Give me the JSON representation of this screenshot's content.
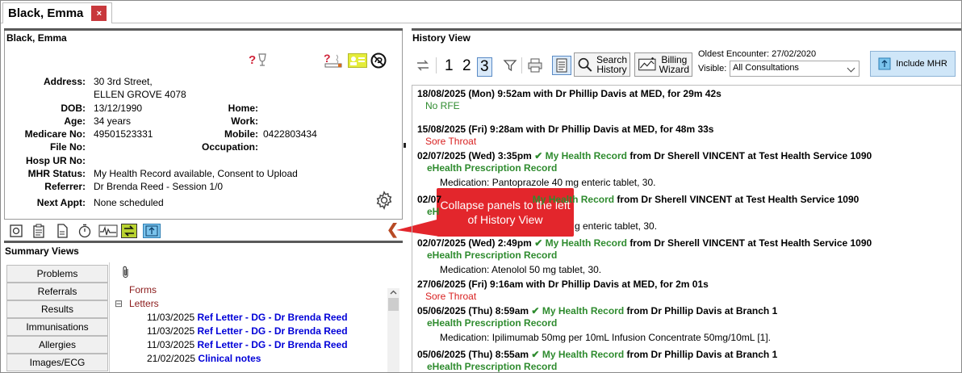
{
  "tab": {
    "title": "Black, Emma",
    "close": "×"
  },
  "patient": {
    "name": "Black, Emma",
    "fields": {
      "address_label": "Address:",
      "address_line1": "30 3rd Street,",
      "address_line2": "ELLEN GROVE  4078",
      "dob_label": "DOB:",
      "dob": "13/12/1990",
      "age_label": "Age:",
      "age": "34 years",
      "medicare_label": "Medicare No:",
      "medicare": "49501523331",
      "file_label": "File No:",
      "hosp_label": "Hosp UR No:",
      "mhr_label": "MHR Status:",
      "mhr": "My Health Record available, Consent to Upload",
      "referrer_label": "Referrer:",
      "referrer": "Dr Brenda Reed - Session 1/0",
      "nextappt_label": "Next Appt:",
      "nextappt": "None scheduled",
      "home_label": "Home:",
      "work_label": "Work:",
      "mobile_label": "Mobile:",
      "mobile": "0422803434",
      "occupation_label": "Occupation:"
    },
    "icons": [
      "question-wine-icon",
      "question-smoking-icon",
      "contact-card-icon",
      "no-resuscitate-icon",
      "settings-gear-icon"
    ]
  },
  "summary": {
    "title": "Summary Views",
    "tabs": [
      "Problems",
      "Referrals",
      "Results",
      "Immunisations",
      "Allergies",
      "Images/ECG"
    ],
    "tree": {
      "forms": "Forms",
      "letters": "Letters",
      "expand_symbol": "⊟",
      "rows": [
        {
          "date": "11/03/2025",
          "text": "Ref Letter - DG - Dr Brenda Reed"
        },
        {
          "date": "11/03/2025",
          "text": "Ref Letter - DG - Dr Brenda Reed"
        },
        {
          "date": "11/03/2025",
          "text": "Ref Letter - DG - Dr Brenda Reed"
        },
        {
          "date": "21/02/2025",
          "text": "Clinical notes"
        }
      ]
    }
  },
  "callout": {
    "text": "Collapse panels to the left of History View",
    "arrow": "❮"
  },
  "history_view": {
    "title": "History View",
    "toolbar": {
      "nums": [
        "1",
        "2",
        "3"
      ],
      "search_history": [
        "Search",
        "History"
      ],
      "billing_wizard": [
        "Billing",
        "Wizard"
      ],
      "oldest_encounter": "Oldest Encounter: 27/02/2020",
      "visible_label": "Visible:",
      "visible_value": "All Consultations",
      "include_mhr": "Include MHR"
    },
    "entries": [
      {
        "header": "18/08/2025 (Mon) 9:52am with Dr Phillip Davis at MED, for 29m 42s",
        "line": "No RFE"
      },
      {
        "header": "15/08/2025 (Fri) 9:28am with Dr Phillip Davis at MED, for 48m 33s",
        "line": "Sore Throat"
      },
      {
        "date": "02/07/2025 (Wed) 3:35pm",
        "mhr": "My Health Record",
        "from": "from Dr Sherell VINCENT  at Test Health Service 1090",
        "sub": "eHealth Prescription Record",
        "med": "Medication: Pantoprazole 40 mg enteric tablet, 30."
      },
      {
        "date": "02/07",
        "mhr": "My Health Record",
        "from": "from Dr Sherell VINCENT  at Test Health Service 1090",
        "sub": "eH",
        "med": "g enteric tablet, 30."
      },
      {
        "date": "02/07/2025 (Wed) 2:49pm",
        "mhr": "My Health Record",
        "from": "from Dr Sherell VINCENT  at Test Health Service 1090",
        "sub": "eHealth Prescription Record",
        "med": "Medication: Atenolol 50 mg tablet, 30."
      },
      {
        "header": "27/06/2025 (Fri) 9:16am with Dr Phillip Davis at MED, for 2m 01s",
        "line": "Sore Throat"
      },
      {
        "date": "05/06/2025 (Thu) 8:59am",
        "mhr": "My Health Record",
        "from": "from Dr Phillip Davis  at Branch 1",
        "sub": "eHealth Prescription Record",
        "med": "Medication: Ipilimumab 50mg per 10mL Infusion Concentrate 50mg/10mL [1]."
      },
      {
        "date": "05/06/2025 (Thu) 8:55am",
        "mhr": "My Health Record",
        "from": "from Dr Phillip Davis  at Branch 1",
        "sub": "eHealth Prescription Record"
      }
    ]
  },
  "colors": {
    "accent_red": "#e3262c",
    "mhr_green": "#2e8b2e",
    "link_blue": "#0000d8",
    "sore_red": "#d81f1f"
  }
}
